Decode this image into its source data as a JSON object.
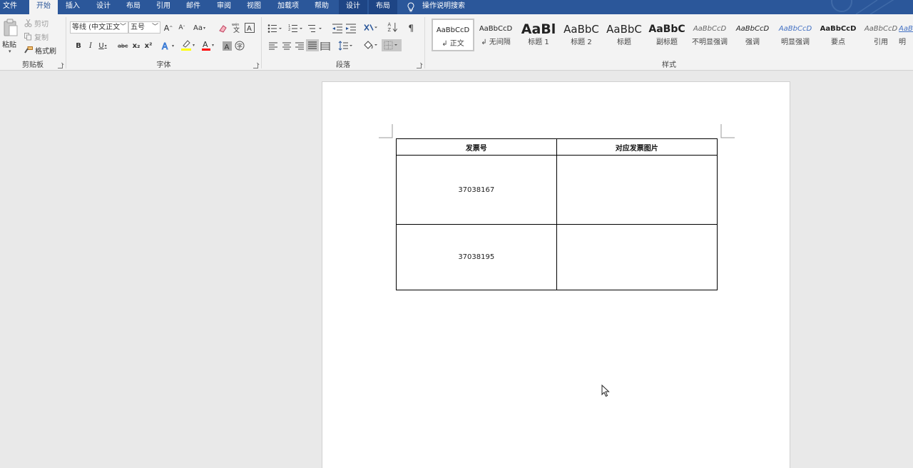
{
  "tabs": [
    {
      "label": "文件",
      "active": false
    },
    {
      "label": "开始",
      "active": true
    },
    {
      "label": "插入",
      "active": false
    },
    {
      "label": "设计",
      "active": false
    },
    {
      "label": "布局",
      "active": false
    },
    {
      "label": "引用",
      "active": false
    },
    {
      "label": "邮件",
      "active": false
    },
    {
      "label": "审阅",
      "active": false
    },
    {
      "label": "视图",
      "active": false
    },
    {
      "label": "加载项",
      "active": false
    },
    {
      "label": "帮助",
      "active": false
    },
    {
      "label": "设计",
      "active": false,
      "contextual": true
    },
    {
      "label": "布局",
      "active": false,
      "contextual": true
    }
  ],
  "tell_me": {
    "label": "操作说明搜索",
    "icon": "lightbulb-icon"
  },
  "clipboard": {
    "paste_label": "粘贴",
    "cut_label": "剪切",
    "copy_label": "复制",
    "format_painter_label": "格式刷",
    "group_label": "剪贴板"
  },
  "font": {
    "font_name": "等线 (中文正文",
    "font_size": "五号",
    "group_label": "字体",
    "bold": "B",
    "italic": "I",
    "underline": "U",
    "strike": "abc",
    "subscript": "x₂",
    "superscript": "x²",
    "grow": "A",
    "shrink": "A",
    "case": "Aa",
    "highlight_color": "#ffff00",
    "font_color": "#ff0000"
  },
  "paragraph": {
    "group_label": "段落"
  },
  "styles": {
    "group_label": "样式",
    "items": [
      {
        "preview": "AaBbCcD",
        "name": "↲ 正文",
        "selected": true
      },
      {
        "preview": "AaBbCcD",
        "name": "↲ 无间隔"
      },
      {
        "preview": "AaBl",
        "name": "标题 1"
      },
      {
        "preview": "AaBbC",
        "name": "标题 2"
      },
      {
        "preview": "AaBbC",
        "name": "标题"
      },
      {
        "preview": "AaBbC",
        "name": "副标题"
      },
      {
        "preview": "AaBbCcD",
        "name": "不明显强调"
      },
      {
        "preview": "AaBbCcD",
        "name": "强调"
      },
      {
        "preview": "AaBbCcD",
        "name": "明显强调"
      },
      {
        "preview": "AaBbCcD",
        "name": "要点"
      },
      {
        "preview": "AaBbCcD",
        "name": "引用"
      },
      {
        "preview": "AaBb",
        "name": "明"
      }
    ]
  },
  "document": {
    "table": {
      "headers": [
        "发票号",
        "对应发票图片"
      ],
      "rows": [
        [
          "37038167",
          ""
        ],
        [
          "37038195",
          ""
        ]
      ]
    }
  },
  "colors": {
    "ribbon_blue": "#2b579a",
    "ribbon_bg": "#f3f3f3",
    "doc_bg": "#e9e9e9"
  }
}
